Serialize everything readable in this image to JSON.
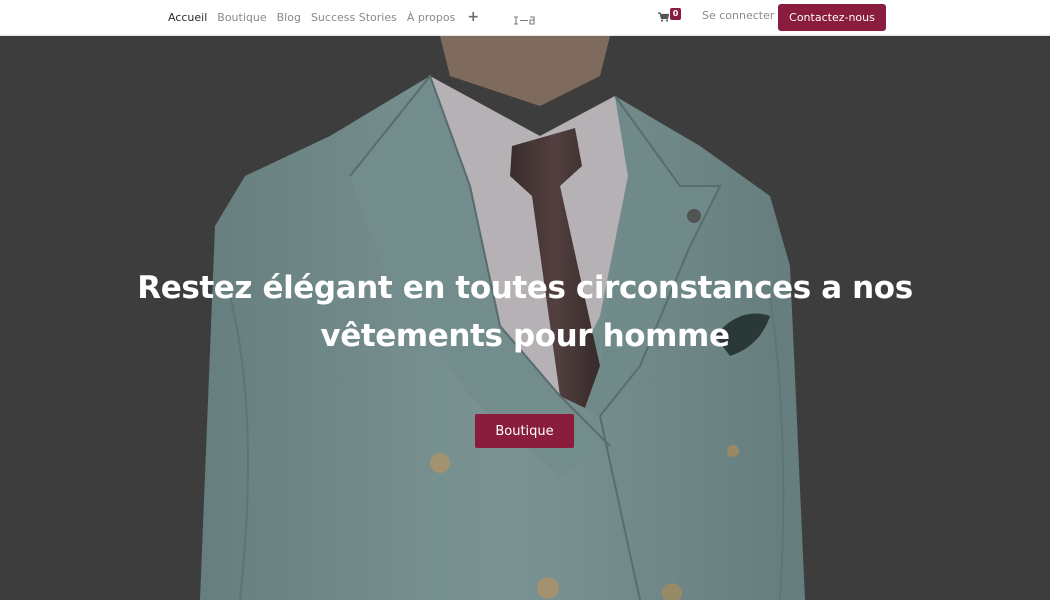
{
  "nav": {
    "links": [
      {
        "label": "Accueil",
        "active": true
      },
      {
        "label": "Boutique",
        "active": false
      },
      {
        "label": "Blog",
        "active": false
      },
      {
        "label": "Success Stories",
        "active": false
      },
      {
        "label": "À propos",
        "active": false
      }
    ],
    "more_icon": "plus-icon",
    "logo_icon": "brand-logo",
    "cart_icon": "shopping-cart-icon",
    "cart_count": "0",
    "login_label": "Se connecter",
    "contact_label": "Contactez-nous"
  },
  "hero": {
    "title": "Restez élégant en toutes circonstances a nos vêtements pour homme",
    "button_label": "Boutique",
    "image_subject": "man in light blue double-breasted suit with brown tie"
  },
  "colors": {
    "accent": "#8a1c3e",
    "hero_background": "#414141",
    "suit": "#7f9a9a"
  }
}
